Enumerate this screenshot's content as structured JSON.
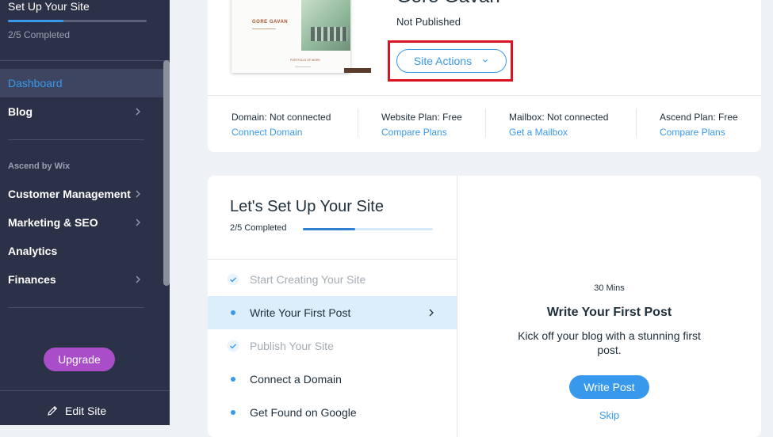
{
  "sidebar": {
    "setup_title": "Set Up Your Site",
    "setup_progress": 0.4,
    "setup_completed": "2/5 Completed",
    "items": [
      {
        "label": "Dashboard",
        "active": true,
        "chevron": false
      },
      {
        "label": "Blog",
        "chevron": true
      }
    ],
    "section_label": "Ascend by Wix",
    "ascend_items": [
      {
        "label": "Customer Management",
        "chevron": true
      },
      {
        "label": "Marketing & SEO",
        "chevron": true
      },
      {
        "label": "Analytics",
        "chevron": false
      },
      {
        "label": "Finances",
        "chevron": true
      }
    ],
    "upgrade_label": "Upgrade",
    "edit_site_label": "Edit Site",
    "edit_icon": "pencil-icon"
  },
  "site": {
    "name": "Gore Gavan",
    "status": "Not Published",
    "actions_label": "Site Actions",
    "thumbnail": {
      "name": "GORE GAVAN",
      "caption": "PORTFOLIO OF WORK"
    },
    "info": [
      {
        "label": "Domain: Not connected",
        "link": "Connect Domain"
      },
      {
        "label": "Website Plan: Free",
        "link": "Compare Plans"
      },
      {
        "label": "Mailbox: Not connected",
        "link": "Get a Mailbox"
      },
      {
        "label": "Ascend Plan: Free",
        "link": "Compare Plans"
      }
    ]
  },
  "setup": {
    "title": "Let's Set Up Your Site",
    "completed": "2/5 Completed",
    "progress": 0.4,
    "steps": [
      {
        "label": "Start Creating Your Site",
        "state": "done"
      },
      {
        "label": "Write Your First Post",
        "state": "active"
      },
      {
        "label": "Publish Your Site",
        "state": "done"
      },
      {
        "label": "Connect a Domain",
        "state": "todo"
      },
      {
        "label": "Get Found on Google",
        "state": "todo"
      }
    ],
    "detail": {
      "time": "30 Mins",
      "title": "Write Your First Post",
      "description": "Kick off your blog with a stunning first post.",
      "button": "Write Post",
      "skip": "Skip"
    }
  },
  "colors": {
    "sidebar_bg": "#2b3147",
    "accent": "#3899ec",
    "upgrade": "#aa4dc8",
    "highlight": "#d9141e"
  }
}
